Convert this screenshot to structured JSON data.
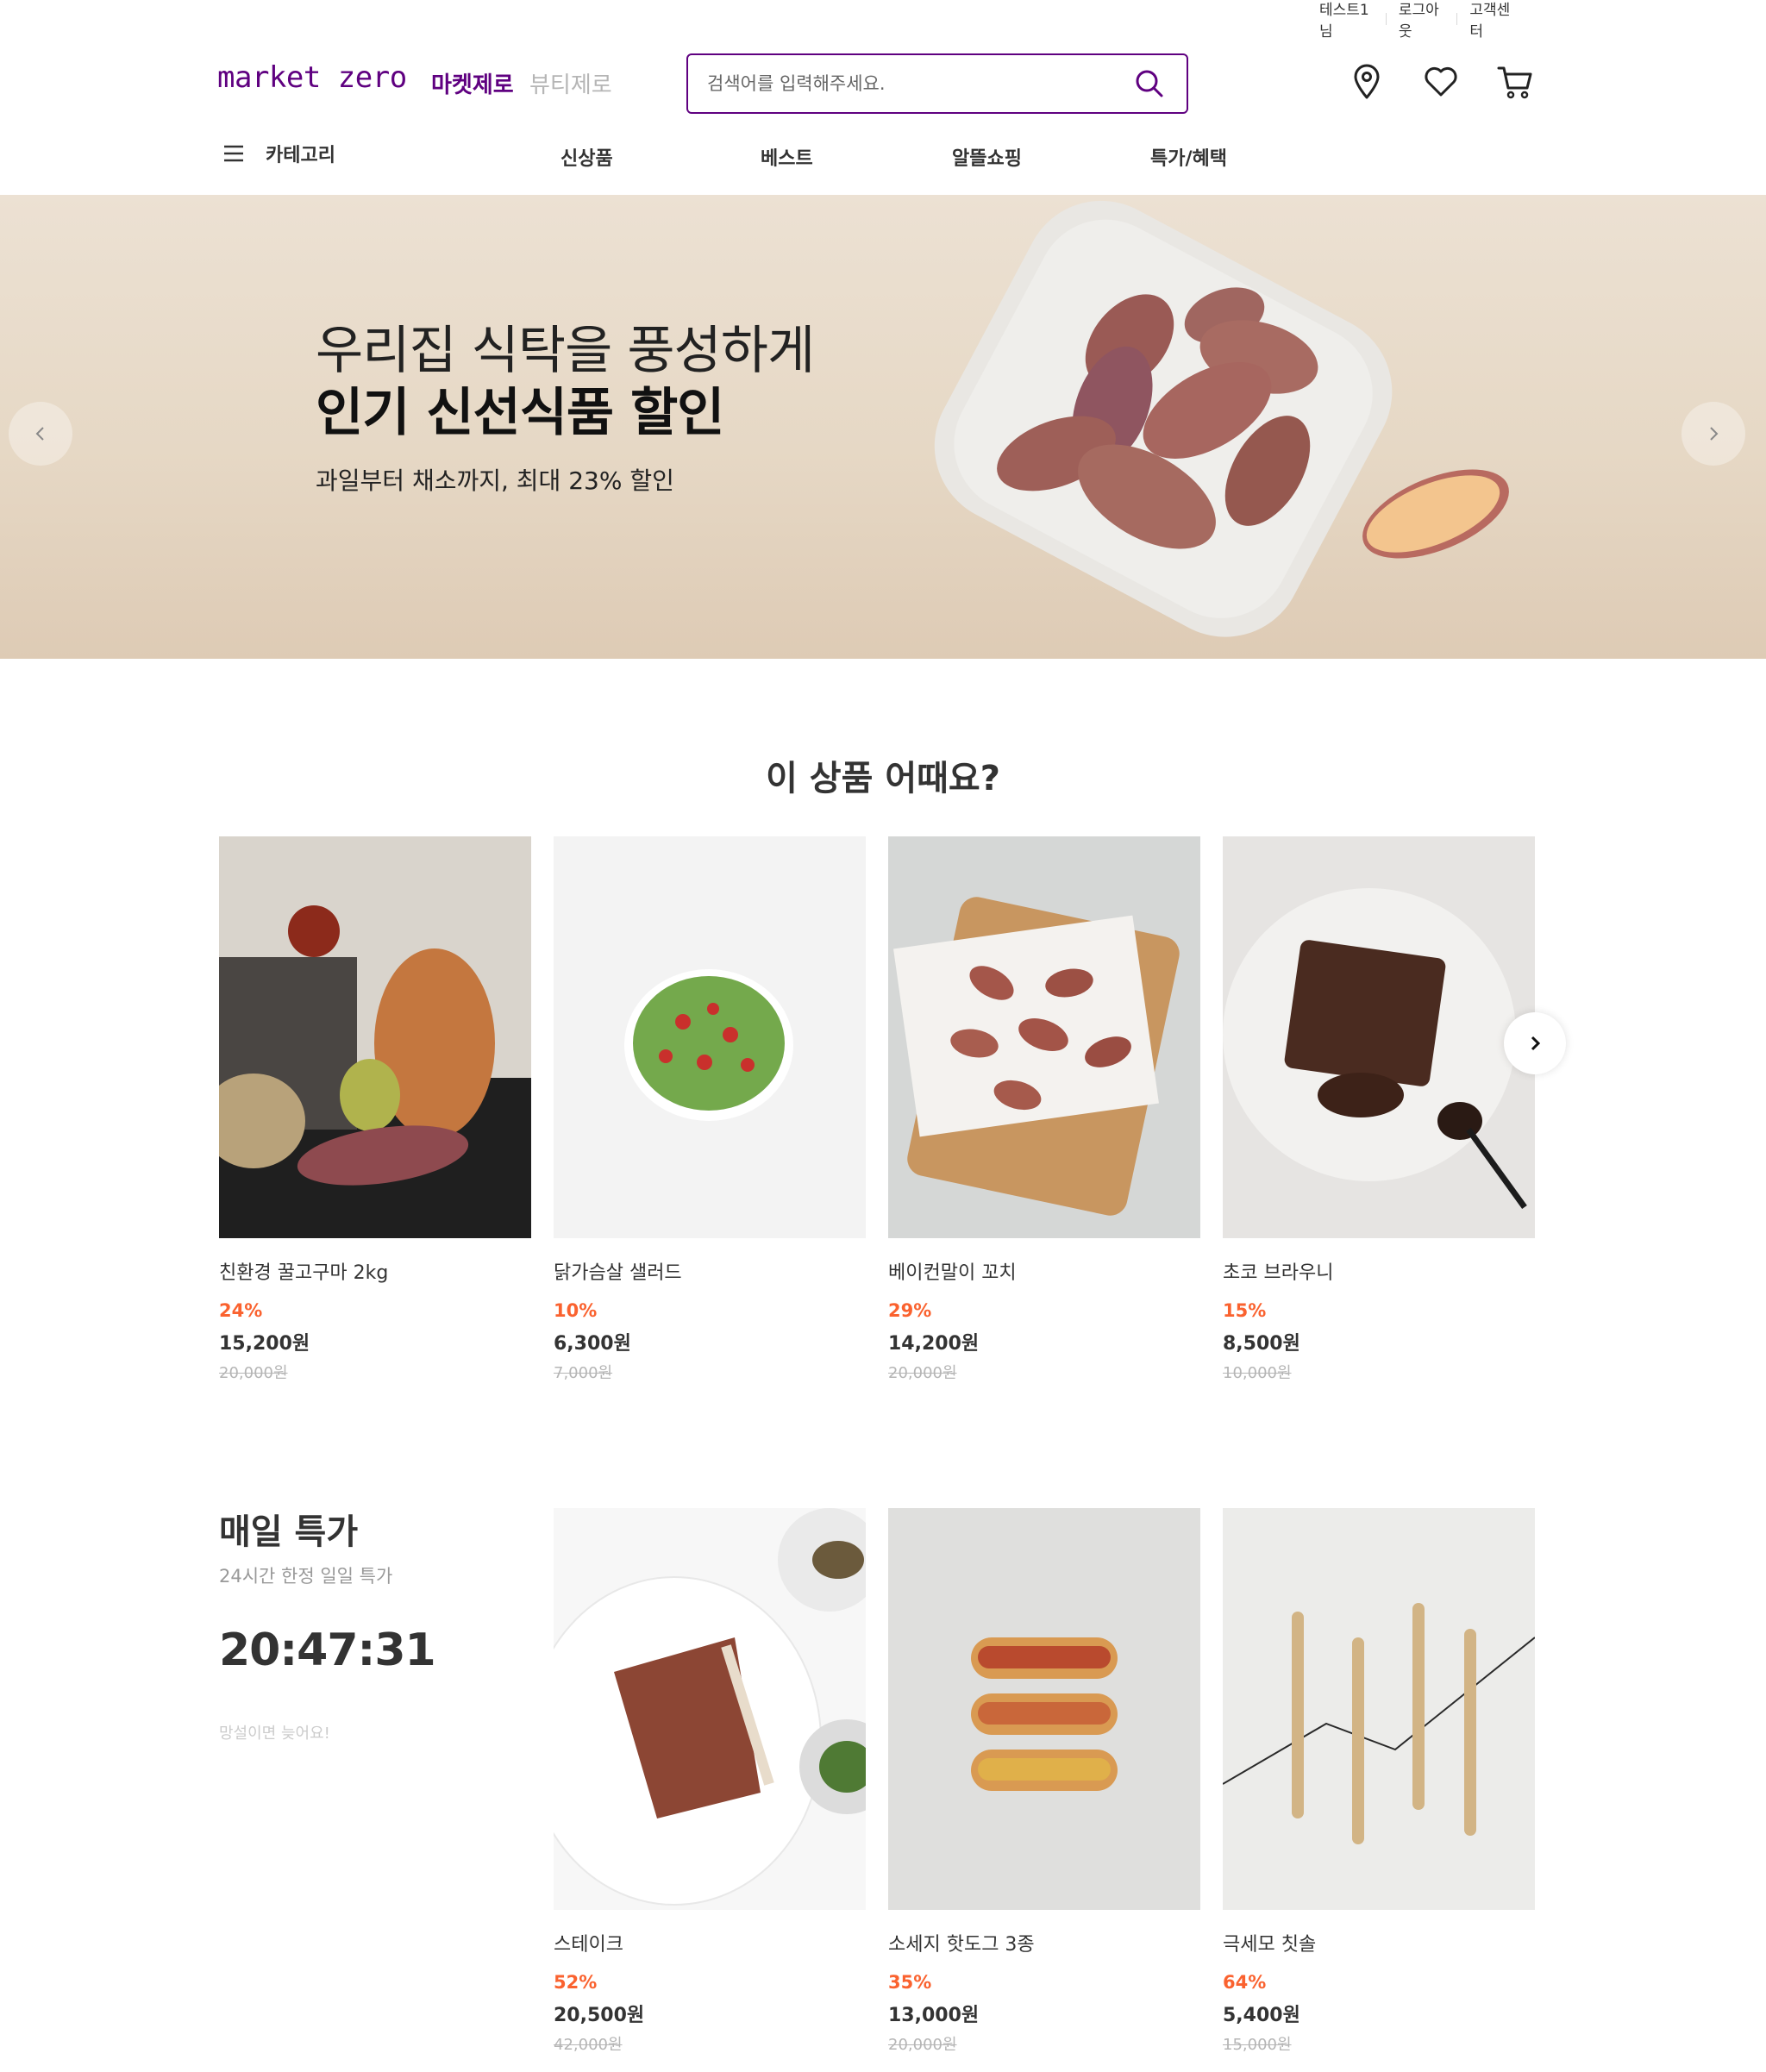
{
  "util": {
    "user": "테스트1님",
    "logout": "로그아웃",
    "cs": "고객센터"
  },
  "header": {
    "logo": "market zero",
    "tab_market": "마켓제로",
    "tab_beauty": "뷰티제로",
    "search_placeholder": "검색어를 입력해주세요.",
    "icons": [
      "location-icon",
      "heart-icon",
      "cart-icon"
    ]
  },
  "gnb": {
    "category": "카테고리",
    "items": [
      "신상품",
      "베스트",
      "알뜰쇼핑",
      "특가/혜택"
    ]
  },
  "banner": {
    "line1": "우리집 식탁을 풍성하게",
    "line2": "인기 신선식품 할인",
    "sub": "과일부터 채소까지, 최대 23% 할인"
  },
  "recommend": {
    "title": "이 상품 어때요?",
    "products": [
      {
        "name": "친환경 꿀고구마 2kg",
        "discount": "24%",
        "price": "15,200원",
        "original": "20,000원"
      },
      {
        "name": "닭가슴살 샐러드",
        "discount": "10%",
        "price": "6,300원",
        "original": "7,000원"
      },
      {
        "name": "베이컨말이 꼬치",
        "discount": "29%",
        "price": "14,200원",
        "original": "20,000원"
      },
      {
        "name": "초코 브라우니",
        "discount": "15%",
        "price": "8,500원",
        "original": "10,000원"
      }
    ]
  },
  "deal": {
    "title": "매일 특가",
    "sub": "24시간 한정 일일 특가",
    "timer": "20:47:31",
    "note": "망설이면 늦어요!",
    "products": [
      {
        "name": "스테이크",
        "discount": "52%",
        "price": "20,500원",
        "original": "42,000원"
      },
      {
        "name": "소세지 핫도그 3종",
        "discount": "35%",
        "price": "13,000원",
        "original": "20,000원"
      },
      {
        "name": "극세모 칫솔",
        "discount": "64%",
        "price": "5,400원",
        "original": "15,000원"
      }
    ]
  },
  "colors": {
    "brand": "#5f0080",
    "discount": "#fa622f",
    "strike": "#b5b5b5"
  }
}
